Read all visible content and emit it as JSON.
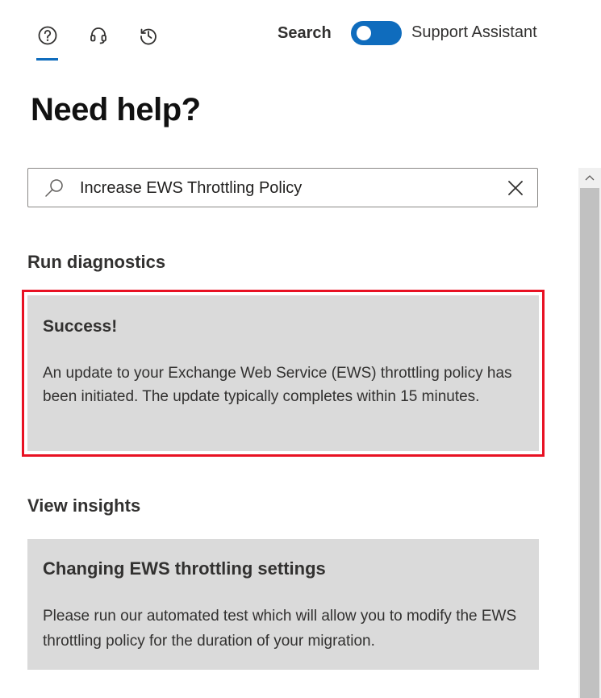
{
  "header": {
    "tabs": [
      {
        "icon": "help-circle-icon",
        "active": true
      },
      {
        "icon": "headset-icon",
        "active": false
      },
      {
        "icon": "history-icon",
        "active": false
      }
    ],
    "search_label": "Search",
    "toggle_on": true,
    "assistant_label": "Support Assistant",
    "accent_color": "#0f6cbd"
  },
  "page": {
    "title": "Need help?"
  },
  "search": {
    "value": "Increase EWS Throttling Policy"
  },
  "diagnostics": {
    "section_title": "Run diagnostics",
    "result_title": "Success!",
    "result_body": "An update to your Exchange Web Service (EWS) throttling policy has been initiated. The update typically completes within 15 minutes.",
    "highlight_color": "#e81123"
  },
  "insights": {
    "section_title": "View insights",
    "card_title": "Changing EWS throttling settings",
    "card_body": "Please run our automated test which will allow you to modify the EWS throttling policy for the duration of your migration."
  }
}
